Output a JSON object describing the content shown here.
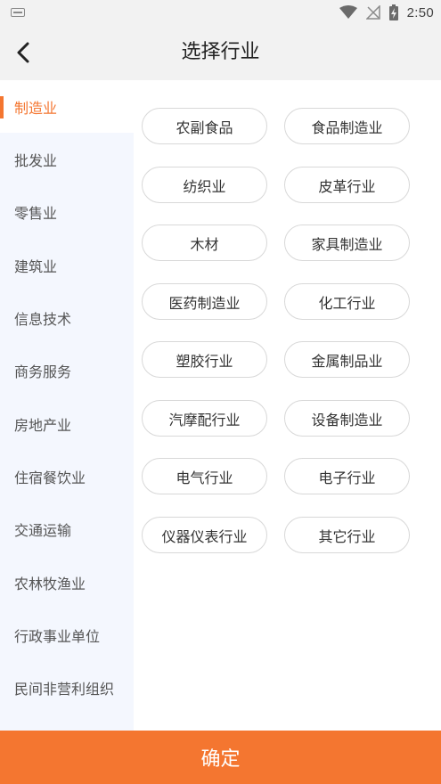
{
  "status_bar": {
    "time": "2:50",
    "keyboard_icon": "keyboard-icon",
    "wifi_icon": "wifi-icon",
    "signal_icon": "no-signal-icon",
    "battery_icon": "battery-charging-icon"
  },
  "nav": {
    "title": "选择行业",
    "back_icon": "chevron-left-icon"
  },
  "sidebar": {
    "active_index": 0,
    "items": [
      "制造业",
      "批发业",
      "零售业",
      "建筑业",
      "信息技术",
      "商务服务",
      "房地产业",
      "住宿餐饮业",
      "交通运输",
      "农林牧渔业",
      "行政事业单位",
      "民间非营利组织"
    ]
  },
  "options": [
    "农副食品",
    "食品制造业",
    "纺织业",
    "皮革行业",
    "木材",
    "家具制造业",
    "医药制造业",
    "化工行业",
    "塑胶行业",
    "金属制品业",
    "汽摩配行业",
    "设备制造业",
    "电气行业",
    "电子行业",
    "仪器仪表行业",
    "其它行业"
  ],
  "confirm_label": "确定",
  "colors": {
    "accent": "#f47630",
    "sidebar_bg": "#f4f7fe",
    "header_bg": "#f2f2f2"
  }
}
